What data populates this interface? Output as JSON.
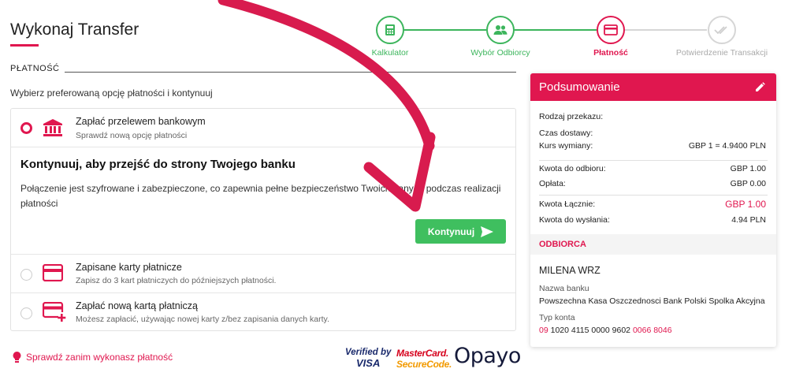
{
  "page": {
    "title": "Wykonaj Transfer",
    "section_label": "PŁATNOŚĆ",
    "instruction": "Wybierz preferowaną opcję płatności i kontynuuj"
  },
  "stepper": {
    "steps": [
      {
        "label": "Kalkulator",
        "state": "done",
        "icon": "calculator-icon"
      },
      {
        "label": "Wybór Odbiorcy",
        "state": "done",
        "icon": "users-icon"
      },
      {
        "label": "Płatność",
        "state": "active",
        "icon": "card-icon"
      },
      {
        "label": "Potwierdzenie Transakcji",
        "state": "pending",
        "icon": "double-check-icon"
      }
    ]
  },
  "payment_options": {
    "bank": {
      "title": "Zapłać przelewem bankowym",
      "subtitle": "Sprawdź nową opcję płatności",
      "selected": true,
      "icon": "bank-icon",
      "heading": "Kontynuuj, aby przejść do strony Twojego banku",
      "description": "Połączenie jest szyfrowane i zabezpieczone, co zapewnia pełne bezpieczeństwo Twoich danych podczas realizacji płatności",
      "button_label": "Kontynuuj"
    },
    "saved_cards": {
      "title": "Zapisane karty płatnicze",
      "subtitle": "Zapisz do 3 kart płatniczych do późniejszych płatności.",
      "selected": false,
      "icon": "credit-card-icon"
    },
    "new_card": {
      "title": "Zapłać nową kartą płatniczą",
      "subtitle": "Możesz zapłacić, używając nowej karty z/bez zapisania danych karty.",
      "selected": false,
      "icon": "add-card-icon"
    }
  },
  "footer": {
    "check_link": "Sprawdź zanim wykonasz płatność",
    "logos": {
      "visa_line1": "Verified by",
      "visa_line2": "VISA",
      "mc_line1": "MasterCard.",
      "mc_line2": "SecureCode.",
      "opayo": "Opayo"
    }
  },
  "summary": {
    "title": "Podsumowanie",
    "rows": {
      "transfer_type": {
        "label": "Rodzaj przekazu:",
        "value": ""
      },
      "delivery_time": {
        "label": "Czas dostawy:",
        "value": ""
      },
      "exchange_rate": {
        "label": "Kurs wymiany:",
        "value": "GBP 1 = 4.9400 PLN"
      },
      "amount_received": {
        "label": "Kwota do odbioru:",
        "value": "GBP 1.00"
      },
      "fee": {
        "label": "Opłata:",
        "value": "GBP 0.00"
      },
      "total": {
        "label": "Kwota Łącznie:",
        "value": "GBP 1.00"
      },
      "amount_sent": {
        "label": "Kwota do wysłania:",
        "value": "4.94 PLN"
      }
    },
    "recipient": {
      "section_title": "ODBIORCA",
      "name": "MILENA WRZ",
      "bank_label": "Nazwa banku",
      "bank_name": "Powszechna Kasa Oszczednosci Bank Polski Spolka Akcyjna",
      "account_type_label": "Typ konta",
      "account_prefix": "09",
      "account_middle": "1020 4115 0000 9602",
      "account_suffix": "0066 8046"
    }
  },
  "colors": {
    "accent": "#e0174f",
    "success": "#3cb55c",
    "button_green": "#3fbf5f"
  }
}
